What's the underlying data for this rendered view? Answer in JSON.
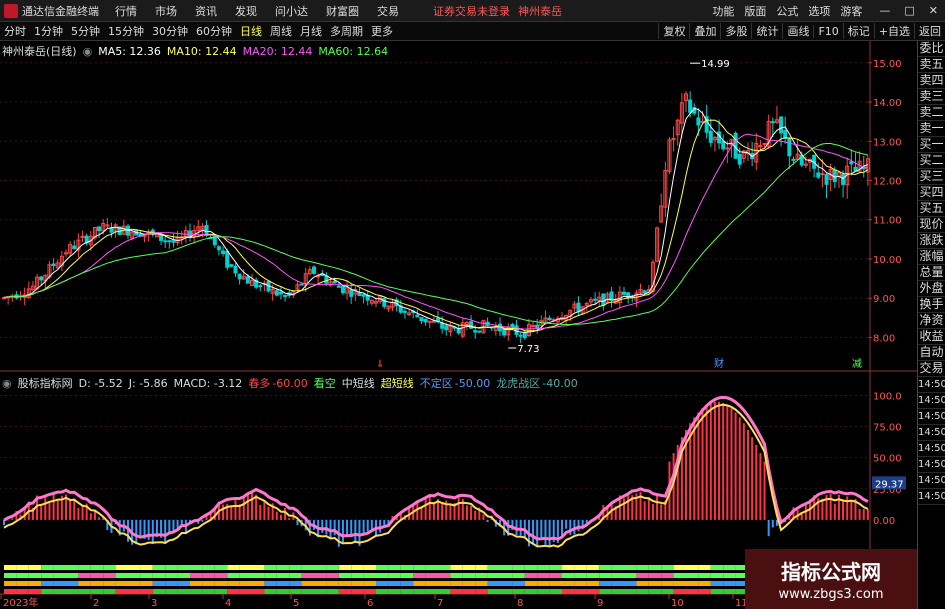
{
  "app": {
    "title": "通达信金融终端"
  },
  "menu": [
    "行情",
    "市场",
    "资讯",
    "发现",
    "问小达",
    "财富圈",
    "交易"
  ],
  "status": {
    "login": "证券交易未登录",
    "stock_name": "神州泰岳"
  },
  "right_menu": [
    "功能",
    "版面",
    "公式",
    "选项",
    "游客"
  ],
  "window_buttons": [
    "—",
    "□",
    "✕"
  ],
  "periods": [
    "分时",
    "1分钟",
    "5分钟",
    "15分钟",
    "30分钟",
    "60分钟",
    "日线",
    "周线",
    "月线",
    "多周期",
    "更多"
  ],
  "active_period": "日线",
  "tools": [
    "复权",
    "叠加",
    "多股",
    "统计",
    "画线",
    "F10",
    "标记",
    "+自选",
    "返回"
  ],
  "main_legend": {
    "stock": "神州泰岳(日线)",
    "ma5": "MA5: 12.36",
    "ma10": "MA10: 12.44",
    "ma20": "MA20: 12.44",
    "ma60": "MA60: 12.64"
  },
  "sub_legend": {
    "name": "股标指标网",
    "d": "D: -5.52",
    "j": "J: -5.86",
    "macd": "MACD: -3.12",
    "chunduo": "春多",
    "chunduo_v": "-60.00",
    "kankong": "看空",
    "zhongduan": "中短线",
    "chaoduan": "超短线",
    "buding": "不定区",
    "buding_v": "-50.00",
    "longhu": "龙虎战区",
    "longhu_v": "-40.00"
  },
  "chart_data": [
    {
      "type": "candlestick",
      "price_axis_ticks": [
        "15.00",
        "14.00",
        "13.00",
        "12.00",
        "11.00",
        "10.00",
        "9.00",
        "8.00"
      ],
      "ylim": [
        7.5,
        15.25
      ],
      "high_label": "14.99",
      "low_label": "7.73",
      "markers": [
        "⇓",
        "财",
        "减"
      ],
      "ma_colors": {
        "ma5": "#ffffff",
        "ma10": "#ffff55",
        "ma20": "#ff55ff",
        "ma60": "#55ff55"
      },
      "grid": true
    },
    {
      "type": "indicator",
      "axis_ticks": [
        "100.0",
        "75.00",
        "50.00",
        "25.00",
        "0.00"
      ],
      "ylim": [
        -25,
        110
      ],
      "current_value": "29.37",
      "grid": true
    }
  ],
  "date_axis": [
    "2023年",
    "2",
    "3",
    "4",
    "5",
    "6",
    "7",
    "8",
    "9",
    "10",
    "11"
  ],
  "side_panel": [
    "委比",
    "卖五",
    "卖四",
    "卖三",
    "卖二",
    "卖一",
    "买一",
    "买二",
    "买三",
    "买四",
    "买五",
    "现价",
    "涨跌",
    "涨幅",
    "总量",
    "外盘",
    "换手",
    "净资",
    "收益",
    "自动",
    "交易",
    "14:50",
    "14:50",
    "14:50",
    "14:50",
    "14:50",
    "14:50",
    "14:50",
    "14:50"
  ],
  "watermark": {
    "title": "指标公式网",
    "url": "www.zbgs3.com"
  }
}
